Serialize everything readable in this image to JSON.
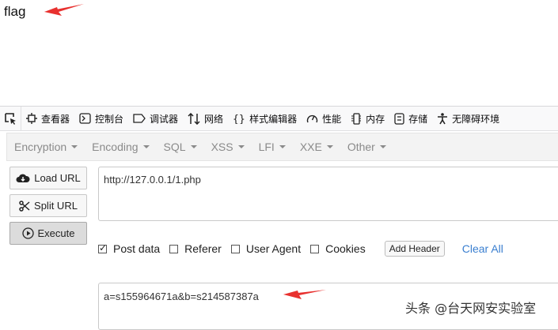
{
  "page": {
    "text": "flag"
  },
  "devtools": {
    "tabs": [
      {
        "label": "查看器",
        "icon": "inspector-icon"
      },
      {
        "label": "控制台",
        "icon": "console-icon"
      },
      {
        "label": "调试器",
        "icon": "debugger-icon"
      },
      {
        "label": "网络",
        "icon": "network-icon"
      },
      {
        "label": "样式编辑器",
        "icon": "style-editor-icon"
      },
      {
        "label": "性能",
        "icon": "performance-icon"
      },
      {
        "label": "内存",
        "icon": "memory-icon"
      },
      {
        "label": "存储",
        "icon": "storage-icon"
      },
      {
        "label": "无障碍环境",
        "icon": "accessibility-icon"
      }
    ]
  },
  "hackbar": {
    "menu": [
      "Encryption",
      "Encoding",
      "SQL",
      "XSS",
      "LFI",
      "XXE",
      "Other"
    ],
    "buttons": {
      "load": "Load URL",
      "split": "Split URL",
      "execute": "Execute"
    },
    "url": "http://127.0.0.1/1.php",
    "options": [
      {
        "label": "Post data",
        "checked": true
      },
      {
        "label": "Referer",
        "checked": false
      },
      {
        "label": "User Agent",
        "checked": false
      },
      {
        "label": "Cookies",
        "checked": false
      }
    ],
    "add_header": "Add Header",
    "clear_all": "Clear All",
    "post_body": "a=s155964671a&b=s214587387a"
  },
  "watermark": "头条 @台天网安实验室",
  "colors": {
    "arrow": "#e8312f",
    "link": "#3a7fd0"
  }
}
